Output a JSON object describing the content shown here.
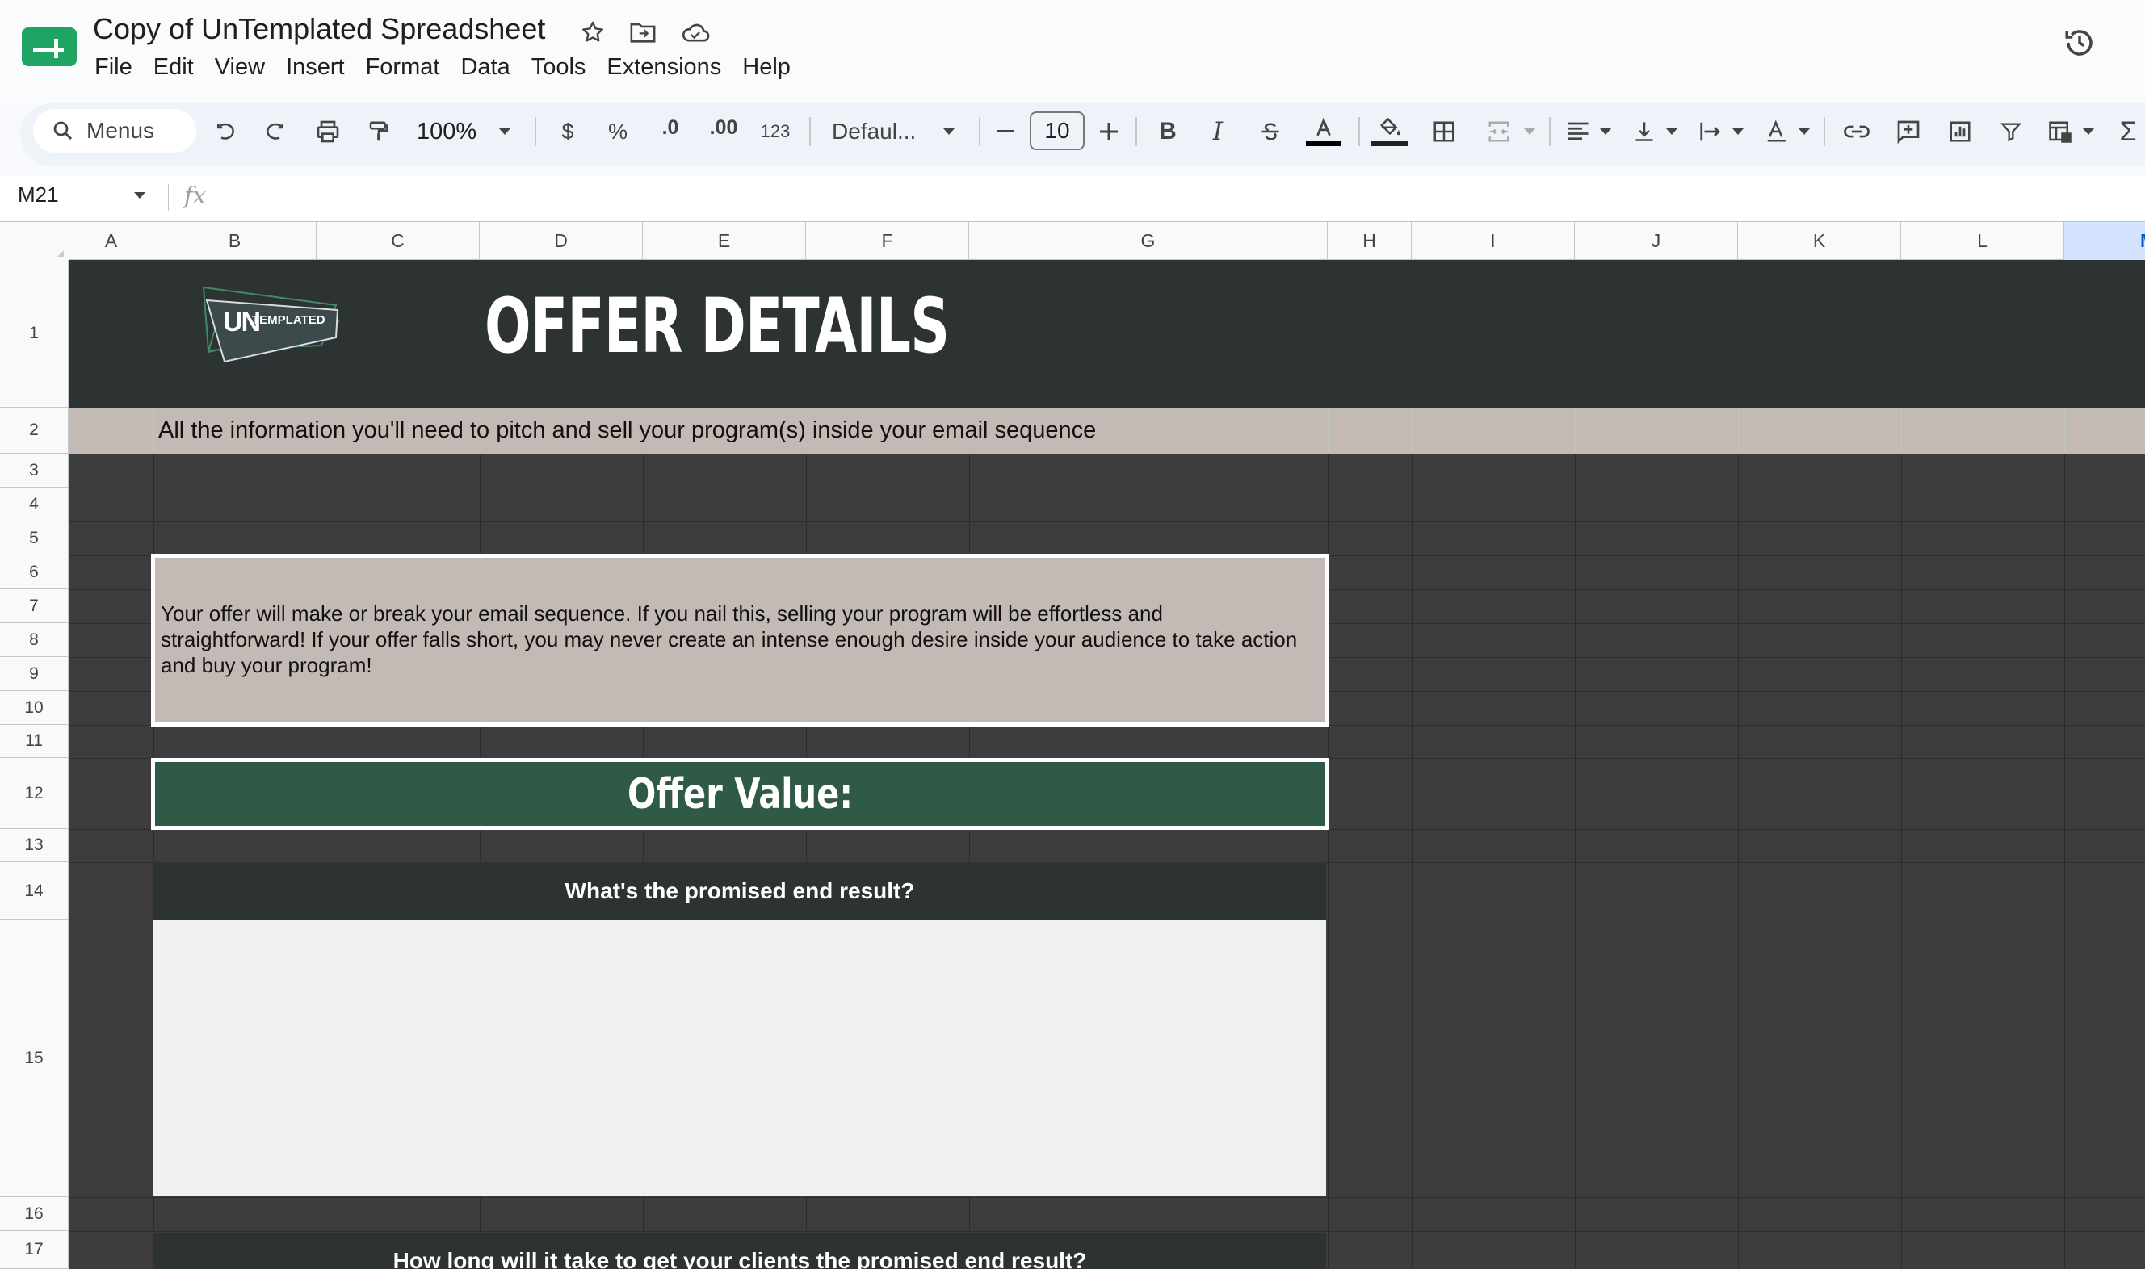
{
  "app": {
    "doc_title": "Copy of UnTemplated Spreadsheet",
    "menus": [
      "File",
      "Edit",
      "View",
      "Insert",
      "Format",
      "Data",
      "Tools",
      "Extensions",
      "Help"
    ]
  },
  "toolbar": {
    "search_label": "Menus",
    "zoom": "100%",
    "currency": "$",
    "percent": "%",
    "decrease_decimal": ".0",
    "increase_decimal": ".00",
    "number_format": "123",
    "font": "Defaul...",
    "font_size": "10",
    "bold": "B",
    "italic": "I",
    "sigma": "Σ"
  },
  "formula_bar": {
    "cell_ref": "M21",
    "fx": "fx"
  },
  "columns": [
    "A",
    "B",
    "C",
    "D",
    "E",
    "F",
    "G",
    "H",
    "I",
    "J",
    "K",
    "L",
    "M"
  ],
  "rows": [
    "1",
    "2",
    "3",
    "4",
    "5",
    "6",
    "7",
    "8",
    "9",
    "10",
    "11",
    "12",
    "13",
    "14",
    "15",
    "16",
    "17"
  ],
  "sheet": {
    "logo_text": "UN",
    "logo_subtext": "TEMPLATED",
    "title": "OFFER DETAILS",
    "tagline": "All the information you'll need to pitch and sell your program(s) inside your email sequence",
    "intro": "Your offer will make or break your email sequence. If you nail this, selling your program will be effortless and straightforward! If your offer falls short, you may never create an intense enough desire inside your audience to take action and buy your program!",
    "section_heading": "Offer Value:",
    "question_1": "What's the promised end result?",
    "question_2": "How long will it take to get your clients the promised end result?"
  },
  "colors": {
    "banner": "#2d3232",
    "sheet_bg": "#3d3d3d",
    "beige": "#c3bab5",
    "green": "#2f5a46",
    "app_green": "#1fa463"
  }
}
